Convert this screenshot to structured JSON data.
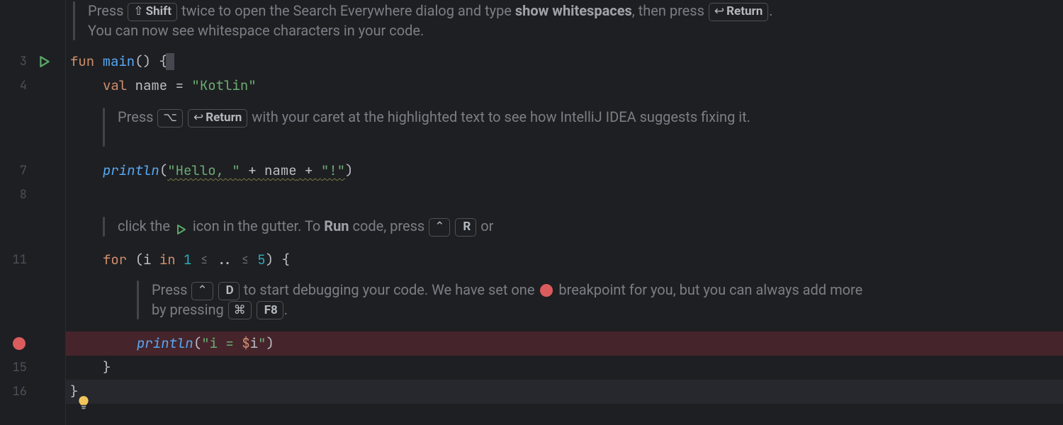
{
  "gutter": {
    "lines": {
      "l3": "3",
      "l4": "4",
      "l7": "7",
      "l8": "8",
      "l11": "11",
      "l15": "15",
      "l16": "16"
    }
  },
  "code": {
    "l3": {
      "kw": "fun ",
      "fn": "main",
      "rest": "() {"
    },
    "l4": {
      "kw": "val ",
      "var": "name",
      "eq": " = ",
      "str": "\"Kotlin\""
    },
    "l7": {
      "fn": "println",
      "lp": "(",
      "s1": "\"Hello, \"",
      "p1": " + ",
      "v": "name",
      "p2": " + ",
      "s2": "\"!\"",
      "rp": ")"
    },
    "l11": {
      "kw": "for ",
      "lp": "(",
      "v": "i",
      "in": " in ",
      "a": "1",
      "r1": " ≤ ",
      "dots": "..",
      "r2": " ≤ ",
      "b": "5",
      "rp": ") {"
    },
    "l14": {
      "fn": "println",
      "lp": "(",
      "s1": "\"i = ",
      "d": "$",
      "iv": "i",
      "s2": "\"",
      "rp": ")"
    },
    "l15": "}",
    "l16": "}"
  },
  "hints": {
    "top": {
      "pre": "Press ",
      "k1_sym": "⇧",
      "k1_label": "Shift",
      "mid1": " twice to open the Search Everywhere dialog and type ",
      "b1": "show whitespaces",
      "mid2": ", then press ",
      "k2_sym": "↩",
      "k2_label": "Return",
      "post": ". You can now see whitespace characters in your code."
    },
    "fix": {
      "pre": "Press ",
      "k1": "⌥",
      "k2_sym": "↩",
      "k2_label": "Return",
      "post": " with your caret at the highlighted text to see how IntelliJ IDEA suggests fixing it."
    },
    "run": {
      "pre": "click the ",
      "mid": " icon in the gutter. To ",
      "b": "Run",
      "mid2": " code, press ",
      "k1": "⌃",
      "k2": "R",
      "post": " or"
    },
    "debug": {
      "pre": "Press ",
      "k1": "⌃",
      "k2": "D",
      "mid": " to start debugging your code. We have set one ",
      "mid2": " breakpoint for you, but you can always add more by pressing ",
      "k3": "⌘",
      "k4": "F8",
      "post": "."
    }
  }
}
